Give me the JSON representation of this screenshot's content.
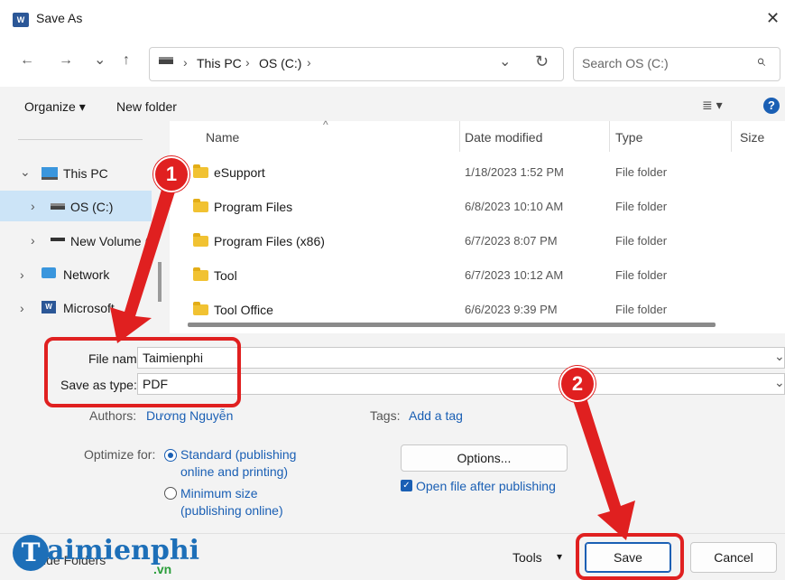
{
  "window": {
    "title": "Save As",
    "app_icon_text": "W",
    "close_glyph": "✕"
  },
  "nav": {
    "back": "←",
    "forward": "→",
    "recent": "⌄",
    "up": "↑"
  },
  "address": {
    "crumbs": [
      "This PC",
      "OS (C:)"
    ],
    "sep": "›",
    "dropdown": "⌄",
    "refresh": "↻"
  },
  "search": {
    "placeholder": "Search OS (C:)",
    "icon": "⌕"
  },
  "toolbar": {
    "organize": "Organize ▾",
    "new_folder": "New folder",
    "view_glyph": "≣ ▾",
    "help": "?"
  },
  "sidebar": {
    "items": [
      {
        "label": "This PC",
        "expander": "⌄"
      },
      {
        "label": "OS (C:)",
        "expander": "›"
      },
      {
        "label": "New Volume (",
        "expander": "›"
      },
      {
        "label": "Network",
        "expander": "›"
      },
      {
        "label": "Microsoft",
        "expander": "›"
      }
    ]
  },
  "columns": {
    "name": "Name",
    "date": "Date modified",
    "type": "Type",
    "size": "Size",
    "sort_glyph": "^"
  },
  "files": [
    {
      "name": "eSupport",
      "date": "1/18/2023 1:52 PM",
      "type": "File folder"
    },
    {
      "name": "Program Files",
      "date": "6/8/2023 10:10 AM",
      "type": "File folder"
    },
    {
      "name": "Program Files (x86)",
      "date": "6/7/2023 8:07 PM",
      "type": "File folder"
    },
    {
      "name": "Tool",
      "date": "6/7/2023 10:12 AM",
      "type": "File folder"
    },
    {
      "name": "Tool Office",
      "date": "6/6/2023 9:39 PM",
      "type": "File folder"
    }
  ],
  "form": {
    "file_name_label": "File name:",
    "file_name_value": "Taimienphi",
    "save_type_label": "Save as type:",
    "save_type_value": "PDF",
    "authors_label": "Authors:",
    "authors_value": "Dương Nguyễn",
    "tags_label": "Tags:",
    "tags_value": "Add a tag",
    "optimize_label": "Optimize for:",
    "opt_standard_1": "Standard (publishing",
    "opt_standard_2": "online and printing)",
    "opt_min_1": "Minimum size",
    "opt_min_2": "(publishing online)",
    "options_button": "Options...",
    "open_after_label": "Open file after publishing",
    "dropdown_glyph": "⌄"
  },
  "footer": {
    "hide_folders": "ide Folders",
    "tools": "Tools",
    "tools_caret": "▾",
    "save": "Save",
    "cancel": "Cancel"
  },
  "annotations": {
    "step1": "1",
    "step2": "2"
  },
  "watermark": {
    "brand": "aimienphi",
    "brand_initial": "T",
    "domain": ".vn"
  },
  "colors": {
    "accent": "#1a5fb4",
    "annotation": "#e02020",
    "selection": "#cce4f7",
    "folder": "#f1c232"
  }
}
